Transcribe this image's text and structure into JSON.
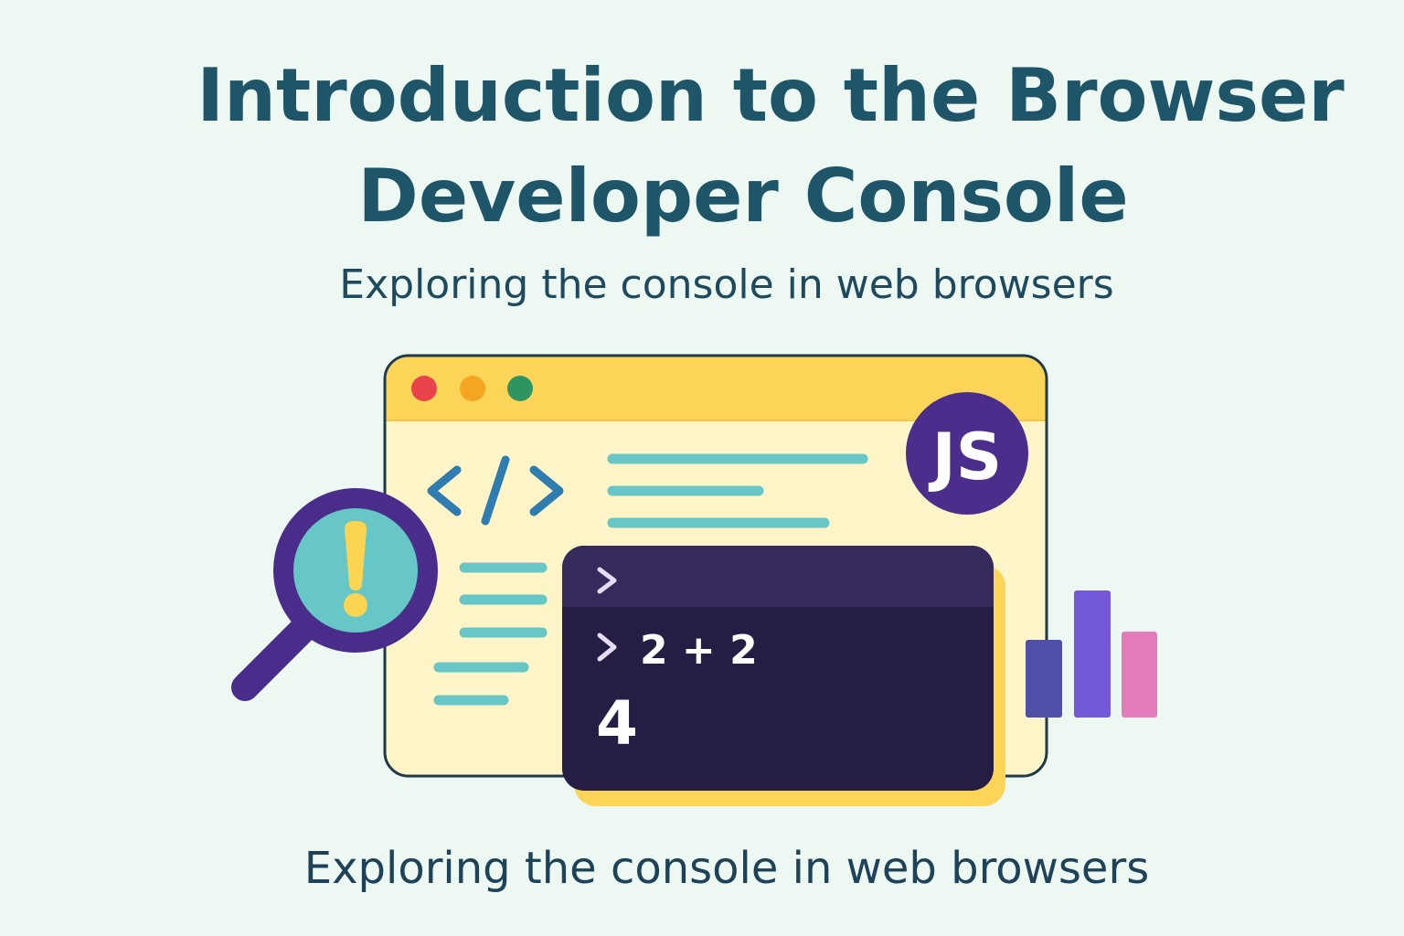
{
  "title": {
    "line1": "Introduction to the Browser",
    "line2": "Developer Console"
  },
  "subtitle": "Exploring the console in web browsers",
  "footer_text": "Exploring the console in web browsers",
  "illustration": {
    "browser_window": {
      "title_bar_dots": [
        {
          "name": "close",
          "color": "#e8434b"
        },
        {
          "name": "minimize",
          "color": "#f4a623"
        },
        {
          "name": "maximize",
          "color": "#2e9461"
        }
      ],
      "title_bar_color": "#fcd558",
      "body_color": "#fdf4c8",
      "code_icon": "code-brackets-icon",
      "badge_label": "JS",
      "badge_color": "#4b2d8c"
    },
    "console": {
      "prompt_symbol": ">",
      "input_expression": "2 + 2",
      "result": "4",
      "background": "#261d45",
      "header_background": "#362a5d"
    },
    "magnifier": {
      "icon": "magnifying-glass-warning-icon",
      "alert_symbol": "!"
    },
    "bar_chart_icon": {
      "icon": "bar-chart-icon",
      "colors": [
        "#4f4fa8",
        "#7358d8",
        "#e27bb8"
      ]
    },
    "colors": {
      "accent_teal": "#67c6c6",
      "accent_purple": "#4a2d8a",
      "accent_yellow": "#fbd552",
      "outline": "#1f3a48"
    }
  }
}
